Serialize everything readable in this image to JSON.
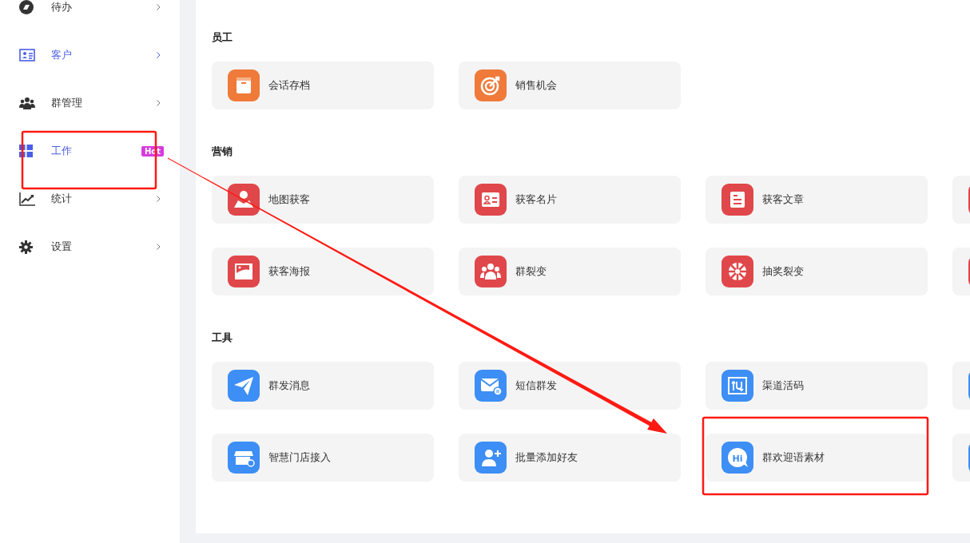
{
  "sidebar": {
    "items": [
      {
        "label": "待办",
        "selected": false,
        "chevron": true
      },
      {
        "label": "客户",
        "selected": true,
        "chevron": true
      },
      {
        "label": "群管理",
        "selected": false,
        "chevron": true
      },
      {
        "label": "工作",
        "selected": true,
        "chevron": false,
        "badge": "Hot"
      },
      {
        "label": "统计",
        "selected": false,
        "chevron": true
      },
      {
        "label": "设置",
        "selected": false,
        "chevron": true
      }
    ]
  },
  "sections": [
    {
      "title": "员工",
      "items": [
        {
          "kind": "card",
          "label": "会话存档"
        },
        {
          "kind": "card",
          "label": "销售机会"
        }
      ]
    },
    {
      "title": "营销",
      "items": [
        {
          "kind": "card",
          "label": "地图获客"
        },
        {
          "kind": "card",
          "label": "获客名片"
        },
        {
          "kind": "card",
          "label": "获客文章"
        },
        {
          "kind": "clipped"
        },
        {
          "kind": "card",
          "label": "获客海报"
        },
        {
          "kind": "card",
          "label": "群裂变"
        },
        {
          "kind": "card",
          "label": "抽奖裂变"
        },
        {
          "kind": "clipped"
        }
      ]
    },
    {
      "title": "工具",
      "items": [
        {
          "kind": "card",
          "label": "群发消息"
        },
        {
          "kind": "card",
          "label": "短信群发"
        },
        {
          "kind": "card",
          "label": "渠道活码"
        },
        {
          "kind": "clipped"
        },
        {
          "kind": "card",
          "label": "智慧门店接入"
        },
        {
          "kind": "card",
          "label": "批量添加好友"
        },
        {
          "kind": "card",
          "label": "群欢迎语素材",
          "icon_text": "Hi"
        },
        {
          "kind": "clipped"
        }
      ]
    }
  ],
  "annotations": [
    {
      "kind": "box"
    },
    {
      "kind": "box"
    },
    {
      "kind": "arrow"
    }
  ]
}
